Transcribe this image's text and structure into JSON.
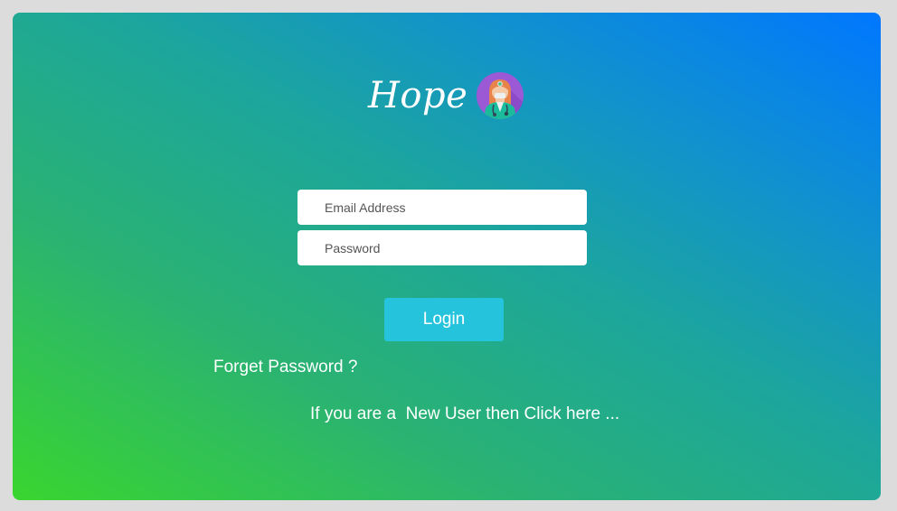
{
  "brand": {
    "name": "Hope",
    "logo_icon": "doctor-avatar-icon"
  },
  "form": {
    "email_placeholder": "Email Address",
    "password_placeholder": "Password",
    "login_label": "Login"
  },
  "links": {
    "forget_password": "Forget Password ?",
    "new_user": "If you are a  New User then Click here ..."
  },
  "colors": {
    "gradient_start": "#3ad52f",
    "gradient_end": "#0077ff",
    "login_button": "#26c3dd",
    "page_background": "#dcdcdc"
  }
}
